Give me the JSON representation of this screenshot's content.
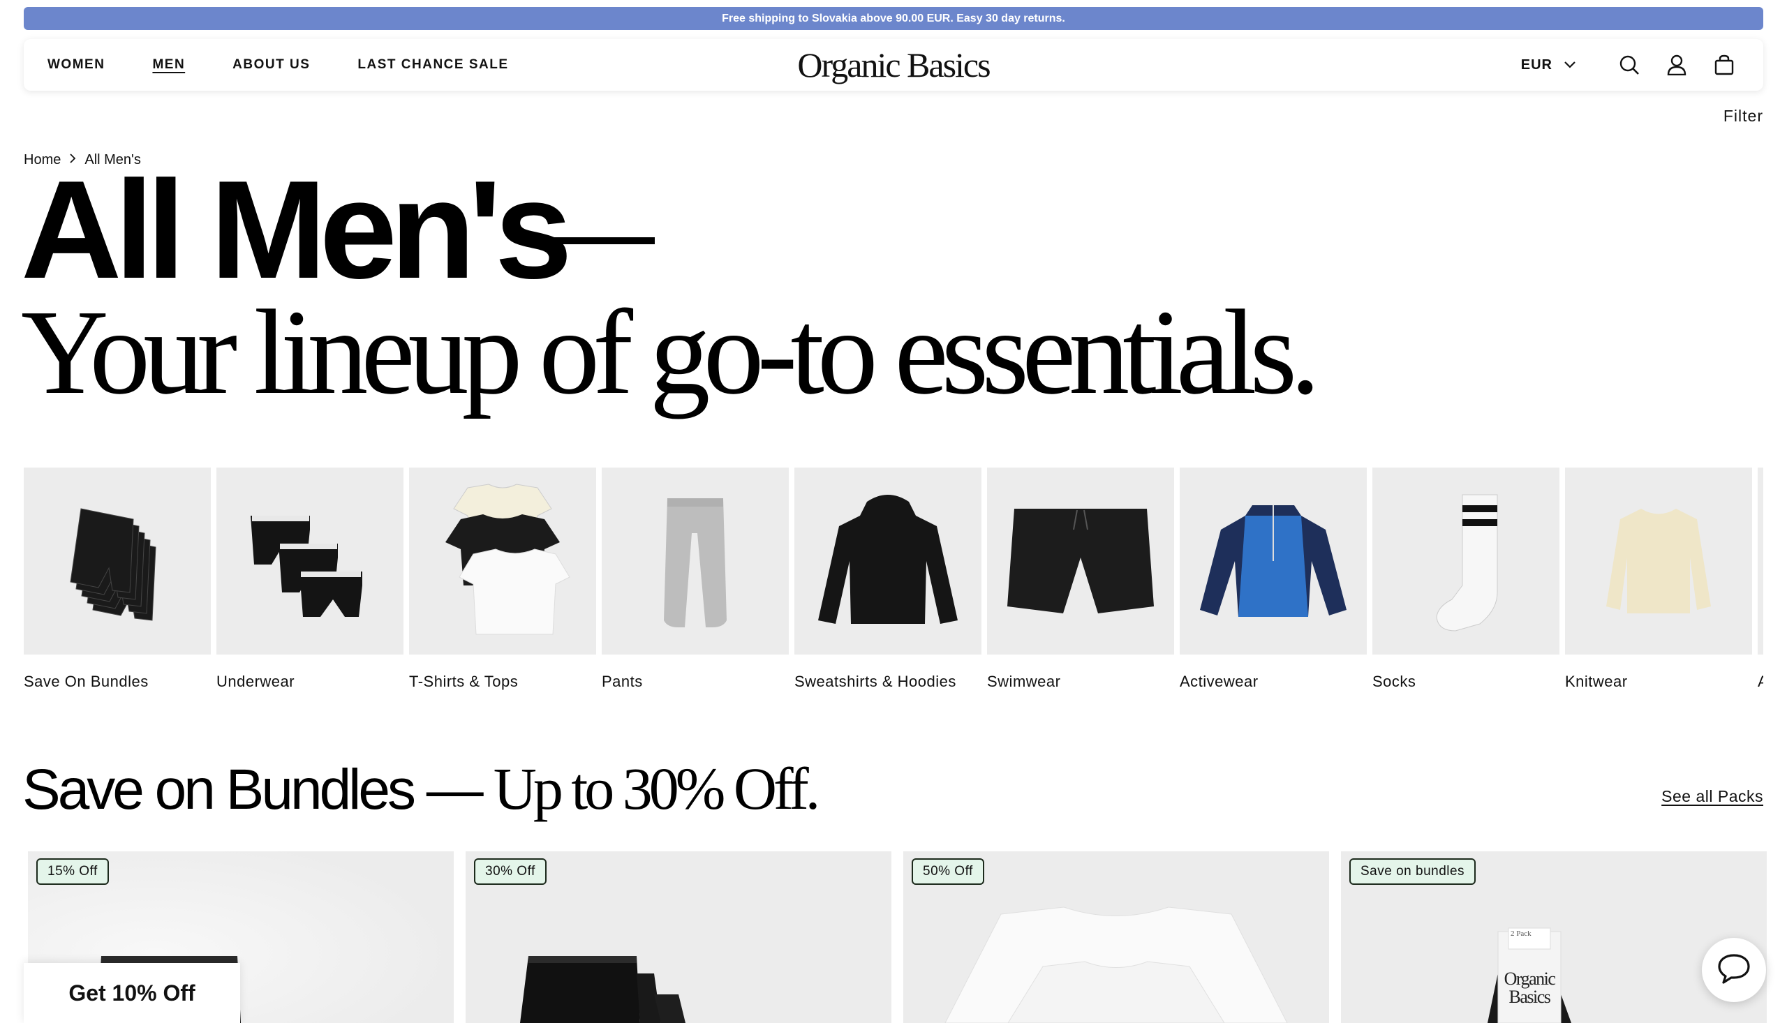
{
  "promo": {
    "text": "Free shipping to Slovakia above 90.00 EUR. Easy 30 day returns."
  },
  "header": {
    "nav": [
      {
        "label": "WOMEN",
        "active": false
      },
      {
        "label": "MEN",
        "active": true
      },
      {
        "label": "ABOUT US",
        "active": false
      },
      {
        "label": "LAST CHANCE SALE",
        "active": false
      }
    ],
    "logo": "Organic Basics",
    "currency": "EUR",
    "icons": [
      "chevron-down-icon",
      "search-icon",
      "account-icon",
      "bag-icon"
    ]
  },
  "filter_label": "Filter",
  "breadcrumb": {
    "home": "Home",
    "current": "All Men's"
  },
  "hero": {
    "title": "All Men's",
    "subtitle": "Your lineup of go-to essentials."
  },
  "categories": [
    {
      "label": "Save On Bundles",
      "icon": "boxer-stack-icon"
    },
    {
      "label": "Underwear",
      "icon": "boxer-briefs-icon"
    },
    {
      "label": "T-Shirts & Tops",
      "icon": "tshirt-stack-icon"
    },
    {
      "label": "Pants",
      "icon": "sweatpants-icon"
    },
    {
      "label": "Sweatshirts & Hoodies",
      "icon": "hoodie-icon"
    },
    {
      "label": "Swimwear",
      "icon": "swim-shorts-icon"
    },
    {
      "label": "Activewear",
      "icon": "half-zip-jacket-icon"
    },
    {
      "label": "Socks",
      "icon": "sock-icon"
    },
    {
      "label": "Knitwear",
      "icon": "sweater-icon"
    },
    {
      "label": "A",
      "icon": "partial-item-icon"
    }
  ],
  "bundles": {
    "title": "Save on Bundles —",
    "subtitle": "Up to 30% Off.",
    "see_all": "See all Packs",
    "products": [
      {
        "badge": "15% Off",
        "image": "boxer-pack-image"
      },
      {
        "badge": "30% Off",
        "image": "boxer-triple-pack-image"
      },
      {
        "badge": "50% Off",
        "image": "white-tee-pack-image"
      },
      {
        "badge": "Save on bundles",
        "image": "sock-pack-image",
        "package_text": "Organic Basics",
        "package_label": "2 Pack"
      }
    ]
  },
  "popup": {
    "label": "Get 10% Off"
  },
  "colors": {
    "promo_bar": "#6c86cc",
    "badge_bg": "#e4f5ea",
    "tile_bg": "#ececec"
  }
}
